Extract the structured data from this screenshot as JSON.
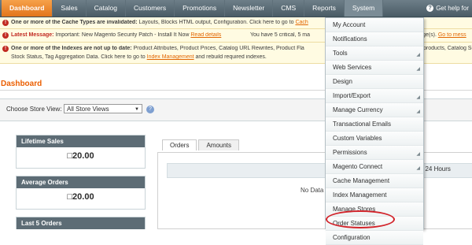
{
  "nav": {
    "items": [
      "Dashboard",
      "Sales",
      "Catalog",
      "Customers",
      "Promotions",
      "Newsletter",
      "CMS",
      "Reports",
      "System"
    ],
    "help": "Get help for"
  },
  "messages": [
    {
      "bold": "One or more of the Cache Types are invalidated:",
      "text": " Layouts, Blocks HTML output, Configuration. Click here to go to ",
      "link": "Cach"
    },
    {
      "bold": "Latest Message:",
      "text": " Important: New Magento Security Patch - Install It Now ",
      "link": "Read details",
      "tail": "You have 5 critical, 5 ma",
      "tail2": "ge(s). ",
      "link2": "Go to mess"
    },
    {
      "bold": "One or more of the Indexes are not up to date:",
      "text": " Product Attributes, Product Prices, Catalog URL Rewrites, Product Fla",
      "tail": "products, Catalog Sea",
      "line2": "Stock Status, Tag Aggregation Data. Click here to go to ",
      "link": "Index Management",
      "line2tail": " and rebuild required indexes."
    }
  ],
  "page_title": "Dashboard",
  "store": {
    "label": "Choose Store View:",
    "selected": "All Store Views"
  },
  "boxes": [
    {
      "header": "Lifetime Sales",
      "value": "□20.00"
    },
    {
      "header": "Average Orders",
      "value": "□20.00"
    },
    {
      "header": "Last 5 Orders"
    }
  ],
  "tabs": [
    "Orders",
    "Amounts"
  ],
  "graph": {
    "no_data": "No Data",
    "range": "st 24 Hours"
  },
  "dropdown": [
    {
      "label": "My Account"
    },
    {
      "label": "Notifications"
    },
    {
      "label": "Tools",
      "sub": true
    },
    {
      "label": "Web Services",
      "sub": true
    },
    {
      "label": "Design"
    },
    {
      "label": "Import/Export",
      "sub": true
    },
    {
      "label": "Manage Currency",
      "sub": true
    },
    {
      "label": "Transactional Emails"
    },
    {
      "label": "Custom Variables"
    },
    {
      "label": "Permissions",
      "sub": true
    },
    {
      "label": "Magento Connect",
      "sub": true
    },
    {
      "label": "Cache Management"
    },
    {
      "label": "Index Management"
    },
    {
      "label": "Manage Stores"
    },
    {
      "label": "Order Statuses"
    },
    {
      "label": "Configuration"
    }
  ],
  "colors": {
    "accent": "#eb5e00",
    "header": "#4a5c66",
    "highlight": "#d2232a"
  }
}
